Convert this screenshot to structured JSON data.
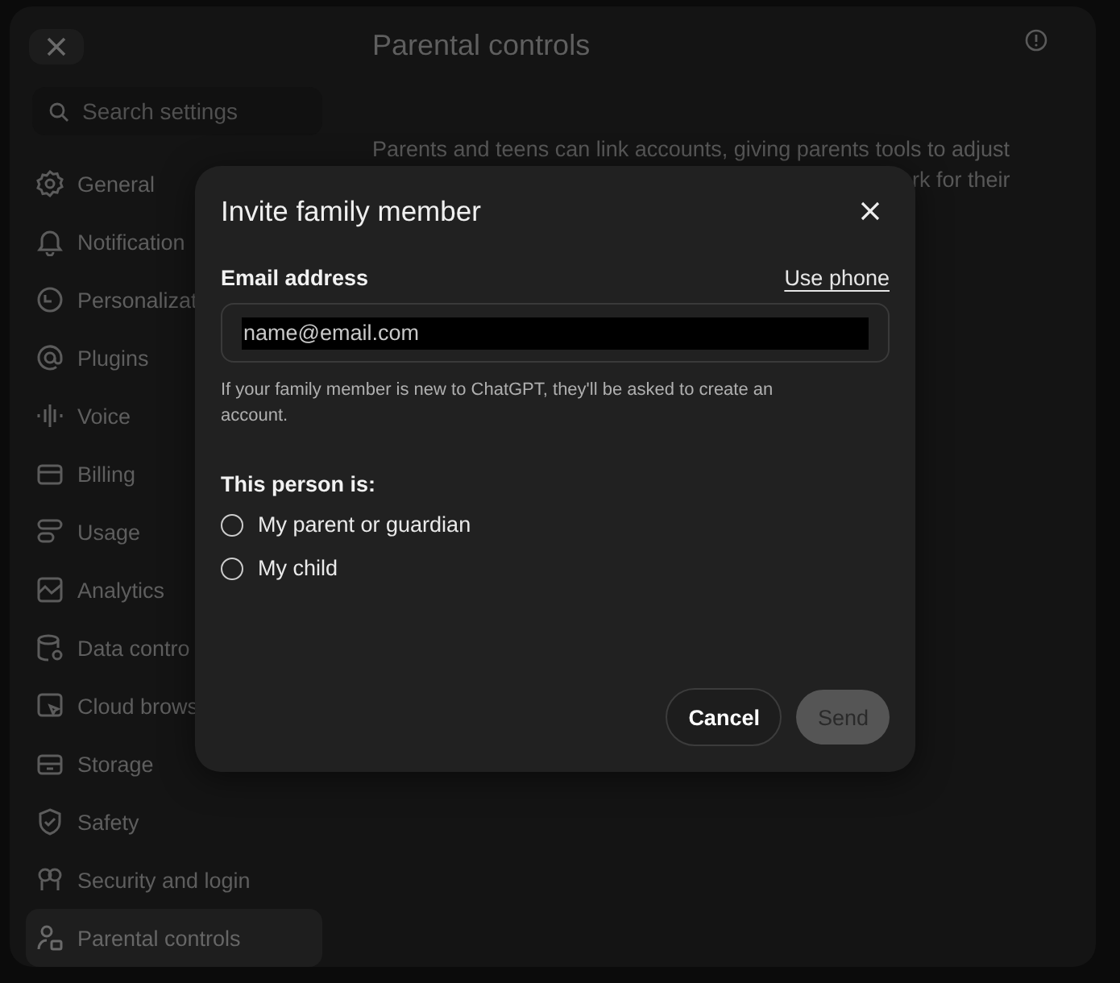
{
  "sidebar": {
    "search": {
      "placeholder": "Search settings"
    },
    "items": [
      {
        "label": "General",
        "selected": false
      },
      {
        "label": "Notification",
        "selected": false
      },
      {
        "label": "Personalizat",
        "selected": false
      },
      {
        "label": "Plugins",
        "selected": false
      },
      {
        "label": "Voice",
        "selected": false
      },
      {
        "label": "Billing",
        "selected": false
      },
      {
        "label": "Usage",
        "selected": false
      },
      {
        "label": "Analytics",
        "selected": false
      },
      {
        "label": "Data contro",
        "selected": false
      },
      {
        "label": "Cloud brows",
        "selected": false
      },
      {
        "label": "Storage",
        "selected": false
      },
      {
        "label": "Safety",
        "selected": false
      },
      {
        "label": "Security and login",
        "selected": false
      },
      {
        "label": "Parental controls",
        "selected": true
      }
    ]
  },
  "page": {
    "title": "Parental controls",
    "description_line_1": "Parents and teens can link accounts, giving parents tools to adjust",
    "description_line_2": "rk for their"
  },
  "dialog": {
    "title": "Invite family member",
    "email_label": "Email address",
    "use_phone": "Use phone",
    "email_placeholder": "name@email.com",
    "hint": "If your family member is new to ChatGPT, they'll be asked to create an account.",
    "relation_label": "This person is:",
    "options": [
      {
        "label": "My parent or guardian",
        "selected": false
      },
      {
        "label": "My child",
        "selected": false
      }
    ],
    "cancel": "Cancel",
    "send": {
      "label": "Send",
      "disabled": true
    }
  }
}
